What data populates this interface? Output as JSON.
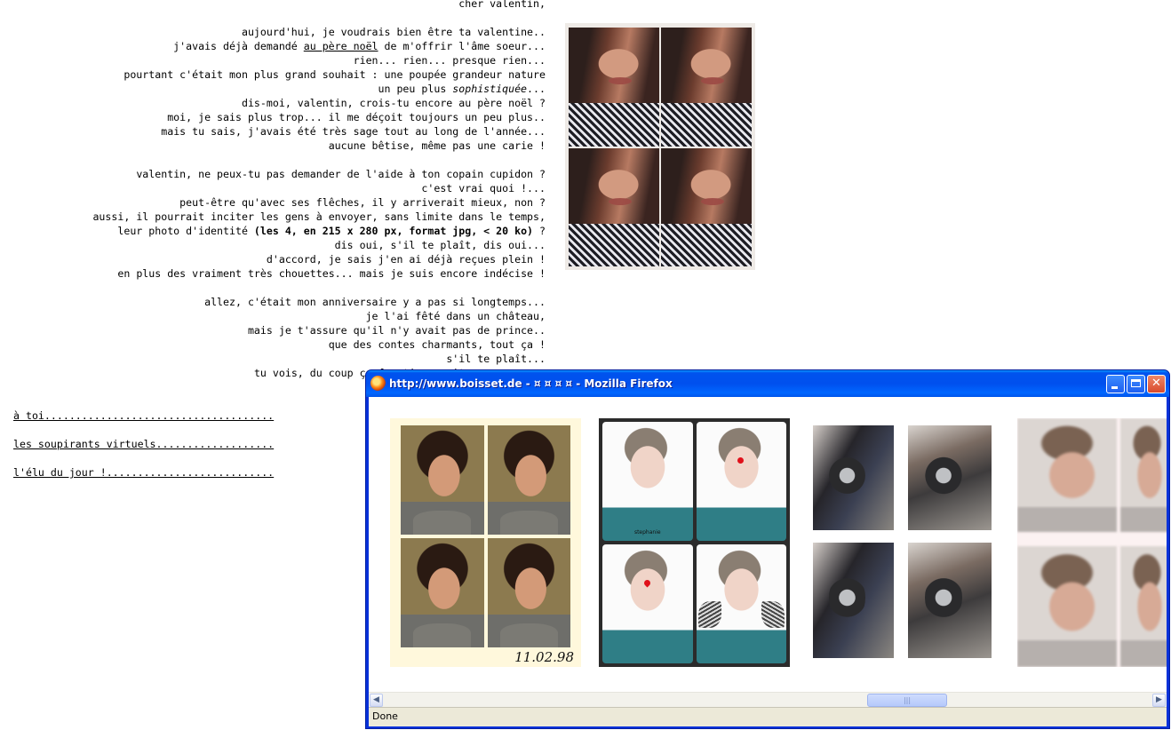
{
  "letter": {
    "lines": [
      "cher valentin,",
      "",
      "aujourd'hui, je voudrais bien être ta valentine..",
      [
        "j'avais déjà demandé ",
        "au père noël",
        " de m'offrir l'âme soeur..."
      ],
      "rien... rien... presque rien...",
      "pourtant c'était mon plus grand souhait : une poupée grandeur nature",
      [
        "un peu plus ",
        "sophistiquée",
        "..."
      ],
      "dis-moi, valentin, crois-tu encore au père noël ?",
      "moi, je sais plus trop... il me déçoit toujours un peu plus..",
      "mais tu sais, j'avais été très sage tout au long de l'année...",
      "aucune bêtise, même pas une carie !",
      "",
      "valentin, ne peux-tu pas demander de l'aide à ton copain cupidon ?",
      "c'est vrai quoi !...",
      "peut-être qu'avec ses flêches, il y arriverait mieux, non ?",
      "aussi, il pourrait inciter les gens à envoyer, sans limite dans le temps,",
      [
        "leur photo d'identité ",
        "(les 4, en 215 x 280 px, format jpg, < 20 ko)",
        " ?"
      ],
      "dis oui, s'il te plaît, dis oui...",
      "d'accord, je sais j'en ai déjà reçues plein !",
      "en plus des vraiment très chouettes... mais je suis encore indécise !",
      "",
      "allez, c'était mon anniversaire y a pas si longtemps...",
      "je l'ai fêté dans un château,",
      "mais je t'assure qu'il n'y avait pas de prince..",
      "que des contes charmants, tout ça !",
      "s'il te plaît...",
      "tu vois, du coup ça fonctionnerait un peu comme"
    ]
  },
  "menu": {
    "items": [
      "à toi.....................................",
      "les soupirants virtuels...................",
      "l'élu du jour !..........................."
    ]
  },
  "popup": {
    "title": "http://www.boisset.de - ¤ ¤ ¤ ¤ - Mozilla Firefox",
    "status": "Done",
    "thumb1_date": "11.02.98",
    "thumb2_label": "stephanie"
  },
  "colors": {
    "titlebar": "#0054e3",
    "close_button": "#d94a2c",
    "status_bar": "#ece9d8"
  },
  "icons": [
    "firefox-logo-icon",
    "minimize-icon",
    "maximize-icon",
    "close-icon",
    "scroll-left-icon",
    "scroll-right-icon"
  ]
}
